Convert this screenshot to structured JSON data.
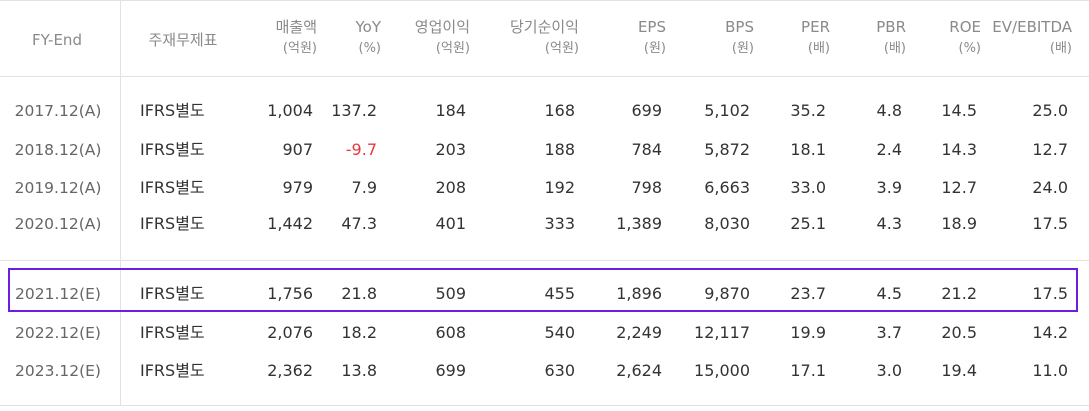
{
  "columns": [
    {
      "label": "FY-End",
      "unit": ""
    },
    {
      "label": "주재무제표",
      "unit": ""
    },
    {
      "label": "매출액",
      "unit": "(억원)"
    },
    {
      "label": "YoY",
      "unit": "(%)"
    },
    {
      "label": "영업이익",
      "unit": "(억원)"
    },
    {
      "label": "당기순이익",
      "unit": "(억원)"
    },
    {
      "label": "EPS",
      "unit": "(원)"
    },
    {
      "label": "BPS",
      "unit": "(원)"
    },
    {
      "label": "PER",
      "unit": "(배)"
    },
    {
      "label": "PBR",
      "unit": "(배)"
    },
    {
      "label": "ROE",
      "unit": "(%)"
    },
    {
      "label": "EV/EBITDA",
      "unit": "(배)"
    }
  ],
  "rows": [
    [
      "2017.12(A)",
      "IFRS별도",
      "1,004",
      "137.2",
      "184",
      "168",
      "699",
      "5,102",
      "35.2",
      "4.8",
      "14.5",
      "25.0"
    ],
    [
      "2018.12(A)",
      "IFRS별도",
      "907",
      "-9.7",
      "203",
      "188",
      "784",
      "5,872",
      "18.1",
      "2.4",
      "14.3",
      "12.7"
    ],
    [
      "2019.12(A)",
      "IFRS별도",
      "979",
      "7.9",
      "208",
      "192",
      "798",
      "6,663",
      "33.0",
      "3.9",
      "12.7",
      "24.0"
    ],
    [
      "2020.12(A)",
      "IFRS별도",
      "1,442",
      "47.3",
      "401",
      "333",
      "1,389",
      "8,030",
      "25.1",
      "4.3",
      "18.9",
      "17.5"
    ],
    [
      "2021.12(E)",
      "IFRS별도",
      "1,756",
      "21.8",
      "509",
      "455",
      "1,896",
      "9,870",
      "23.7",
      "4.5",
      "21.2",
      "17.5"
    ],
    [
      "2022.12(E)",
      "IFRS별도",
      "2,076",
      "18.2",
      "608",
      "540",
      "2,249",
      "12,117",
      "19.9",
      "3.7",
      "20.5",
      "14.2"
    ],
    [
      "2023.12(E)",
      "IFRS별도",
      "2,362",
      "13.8",
      "699",
      "630",
      "2,624",
      "15,000",
      "17.1",
      "3.0",
      "19.4",
      "11.0"
    ]
  ],
  "negative_color": "#e8383d",
  "highlight_color": "#6a1ee0",
  "highlight_row": 4
}
